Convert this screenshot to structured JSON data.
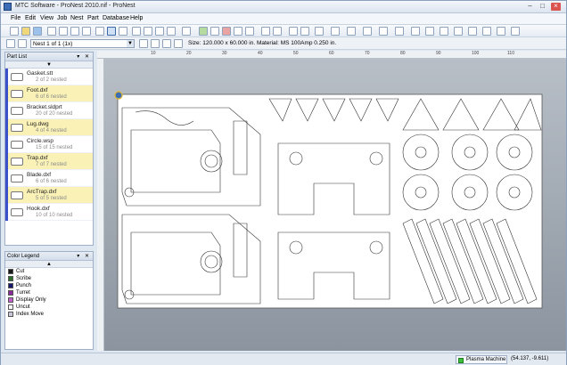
{
  "window": {
    "title": "MTC Software - ProNest 2010.nif - ProNest"
  },
  "menu": [
    "File",
    "Edit",
    "View",
    "Job",
    "Nest",
    "Part",
    "Database",
    "Help"
  ],
  "nest_selector": {
    "value": "Nest 1 of 1 (1x)"
  },
  "plate_info": "Size: 120.000 x 60.000  in.   Material: MS 100Amp 0.250 in.",
  "ruler_labels": [
    "10",
    "20",
    "30",
    "40",
    "50",
    "60",
    "70",
    "80",
    "90",
    "100",
    "110"
  ],
  "part_list": {
    "title": "Part List",
    "items": [
      {
        "name": "Gasket.stt",
        "count": "2 of 2 nested",
        "highlight": false
      },
      {
        "name": "Foot.dxf",
        "count": "6 of 6 nested",
        "highlight": true
      },
      {
        "name": "Bracket.sldprt",
        "count": "20 of 20 nested",
        "highlight": false
      },
      {
        "name": "Lug.dwg",
        "count": "4 of 4 nested",
        "highlight": true
      },
      {
        "name": "Circle.wsp",
        "count": "15 of 15 nested",
        "highlight": false
      },
      {
        "name": "Trap.dxf",
        "count": "7 of 7 nested",
        "highlight": true
      },
      {
        "name": "Blade.dxf",
        "count": "6 of 6 nested",
        "highlight": false
      },
      {
        "name": "ArcTrap.dxf",
        "count": "5 of 5 nested",
        "highlight": true
      },
      {
        "name": "Hook.dxf",
        "count": "10 of 10 nested",
        "highlight": false
      }
    ]
  },
  "color_legend": {
    "title": "Color Legend",
    "items": [
      {
        "label": "Cut",
        "color": "#1a1a1a"
      },
      {
        "label": "Scribe",
        "color": "#2c6e2c"
      },
      {
        "label": "Punch",
        "color": "#15156a"
      },
      {
        "label": "Turret",
        "color": "#8a2a9a"
      },
      {
        "label": "Display Only",
        "color": "#c060c8"
      },
      {
        "label": "Uncut",
        "color": "#ffffff"
      },
      {
        "label": "Index Move",
        "color": "#c8c8d8"
      }
    ]
  },
  "status": {
    "machine": "Plasma Machine",
    "coords": "(54.137, -9.611)"
  }
}
